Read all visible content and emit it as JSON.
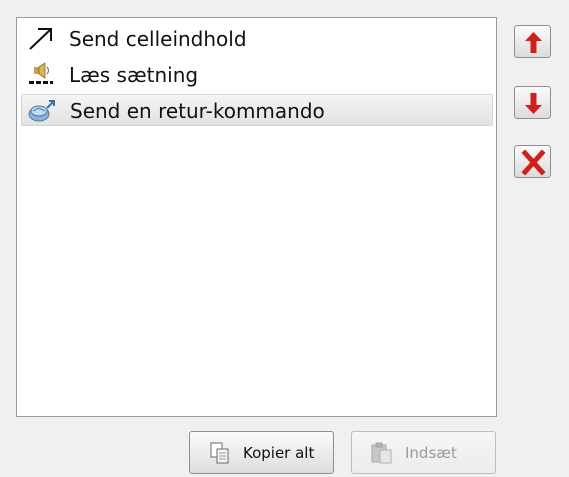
{
  "list": {
    "items": [
      {
        "label": "Send celleindhold",
        "icon": "arrow-up-right-icon",
        "selected": false
      },
      {
        "label": "Læs sætning",
        "icon": "speaker-icon",
        "selected": false
      },
      {
        "label": "Send en retur-kommando",
        "icon": "return-command-icon",
        "selected": true
      }
    ]
  },
  "side_buttons": {
    "move_up": {
      "icon": "arrow-up-icon",
      "color": "#d0201c"
    },
    "move_down": {
      "icon": "arrow-down-icon",
      "color": "#d0201c"
    },
    "delete": {
      "icon": "delete-x-icon",
      "color": "#d0201c"
    }
  },
  "bottom_buttons": {
    "copy_all": {
      "label": "Kopier alt",
      "icon": "copy-icon",
      "enabled": true
    },
    "paste": {
      "label": "Indsæt",
      "icon": "paste-icon",
      "enabled": false
    }
  }
}
